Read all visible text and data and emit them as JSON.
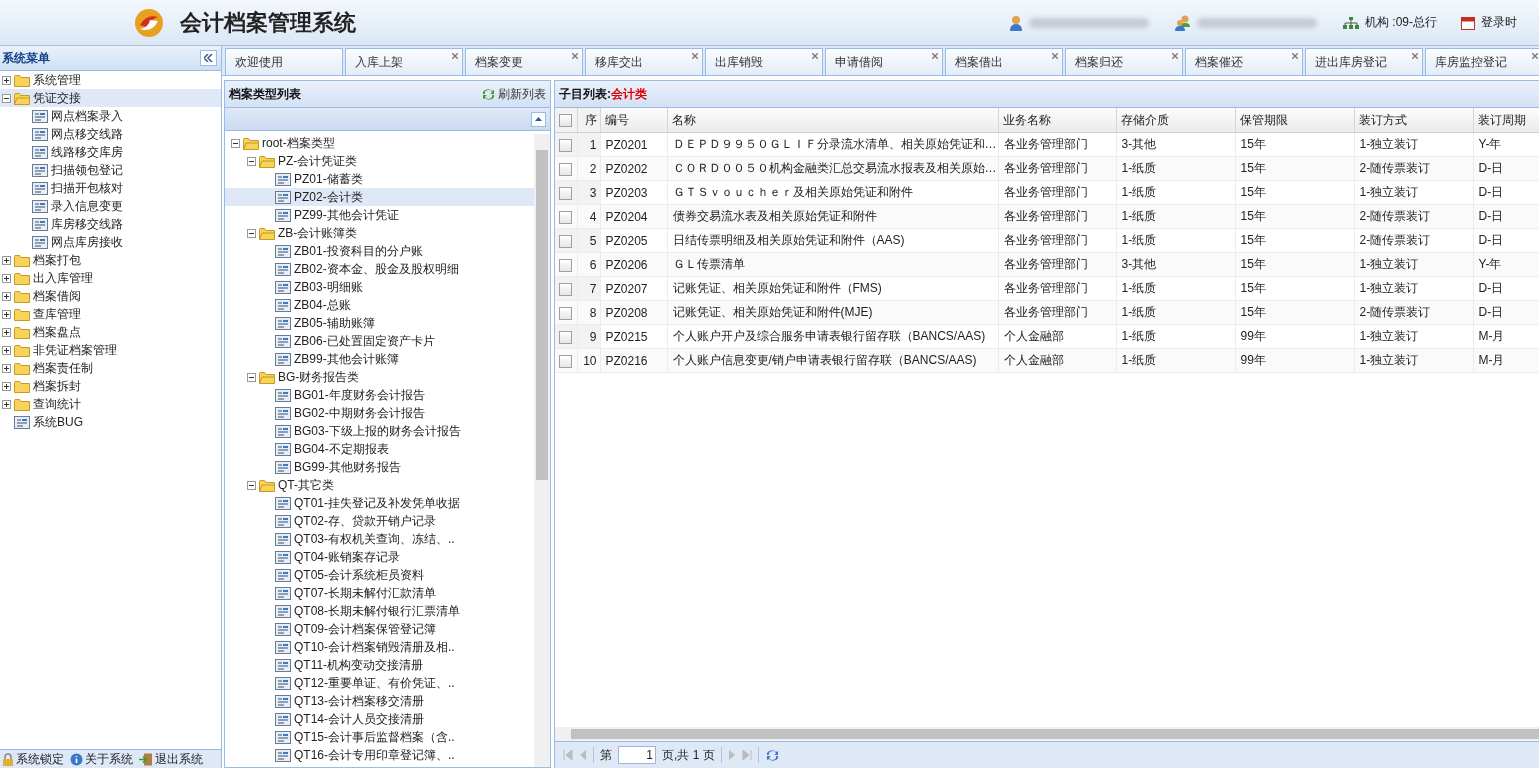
{
  "header": {
    "title": "会计档案管理系统",
    "org": "机构 :09-总行",
    "login": "登录时"
  },
  "sidebar": {
    "title": "系统菜单",
    "items": [
      {
        "label": "系统管理",
        "kind": "folder",
        "expanded": false,
        "selected": false
      },
      {
        "label": "凭证交接",
        "kind": "folder",
        "expanded": true,
        "selected": true,
        "children": [
          {
            "label": "网点档案录入",
            "kind": "page",
            "selected": false
          },
          {
            "label": "网点移交线路",
            "kind": "page",
            "selected": false
          },
          {
            "label": "线路移交库房",
            "kind": "page",
            "selected": false
          },
          {
            "label": "扫描领包登记",
            "kind": "page",
            "selected": false
          },
          {
            "label": "扫描开包核对",
            "kind": "page",
            "selected": false
          },
          {
            "label": "录入信息变更",
            "kind": "page",
            "selected": false
          },
          {
            "label": "库房移交线路",
            "kind": "page",
            "selected": false
          },
          {
            "label": "网点库房接收",
            "kind": "page",
            "selected": false
          }
        ]
      },
      {
        "label": "档案打包",
        "kind": "folder",
        "expanded": false,
        "selected": false
      },
      {
        "label": "出入库管理",
        "kind": "folder",
        "expanded": false,
        "selected": false
      },
      {
        "label": "档案借阅",
        "kind": "folder",
        "expanded": false,
        "selected": false
      },
      {
        "label": "查库管理",
        "kind": "folder",
        "expanded": false,
        "selected": false
      },
      {
        "label": "档案盘点",
        "kind": "folder",
        "expanded": false,
        "selected": false
      },
      {
        "label": "非凭证档案管理",
        "kind": "folder",
        "expanded": false,
        "selected": false
      },
      {
        "label": "档案责任制",
        "kind": "folder",
        "expanded": false,
        "selected": false
      },
      {
        "label": "档案拆封",
        "kind": "folder",
        "expanded": false,
        "selected": false
      },
      {
        "label": "查询统计",
        "kind": "folder",
        "expanded": false,
        "selected": false
      },
      {
        "label": "系统BUG",
        "kind": "page",
        "selected": false
      }
    ],
    "footer": [
      {
        "label": "系统锁定",
        "kind": "lock"
      },
      {
        "label": "关于系统",
        "kind": "info"
      },
      {
        "label": "退出系统",
        "kind": "exit"
      }
    ]
  },
  "tabs": [
    {
      "label": "欢迎使用",
      "selected": false,
      "closable": false
    },
    {
      "label": "入库上架",
      "selected": false,
      "closable": true
    },
    {
      "label": "档案变更",
      "selected": false,
      "closable": true
    },
    {
      "label": "移库交出",
      "selected": false,
      "closable": true
    },
    {
      "label": "出库销毁",
      "selected": false,
      "closable": true
    },
    {
      "label": "申请借阅",
      "selected": false,
      "closable": true
    },
    {
      "label": "档案借出",
      "selected": false,
      "closable": true
    },
    {
      "label": "档案归还",
      "selected": false,
      "closable": true
    },
    {
      "label": "档案催还",
      "selected": false,
      "closable": true
    },
    {
      "label": "进出库房登记",
      "selected": false,
      "closable": true
    },
    {
      "label": "库房监控登记",
      "selected": false,
      "closable": true
    }
  ],
  "type_panel": {
    "title": "档案类型列表",
    "refresh": "刷新列表",
    "tree": [
      {
        "label": "root-档案类型",
        "kind": "folder",
        "expanded": true,
        "selected": false,
        "children": [
          {
            "label": "PZ-会计凭证类",
            "kind": "folder",
            "expanded": true,
            "selected": false,
            "children": [
              {
                "label": "PZ01-储蓄类",
                "kind": "page",
                "selected": false
              },
              {
                "label": "PZ02-会计类",
                "kind": "page",
                "selected": true
              },
              {
                "label": "PZ99-其他会计凭证",
                "kind": "page",
                "selected": false
              }
            ]
          },
          {
            "label": "ZB-会计账簿类",
            "kind": "folder",
            "expanded": true,
            "selected": false,
            "children": [
              {
                "label": "ZB01-投资科目的分户账",
                "kind": "page",
                "selected": false
              },
              {
                "label": "ZB02-资本金、股金及股权明细",
                "kind": "page",
                "selected": false
              },
              {
                "label": "ZB03-明细账",
                "kind": "page",
                "selected": false
              },
              {
                "label": "ZB04-总账",
                "kind": "page",
                "selected": false
              },
              {
                "label": "ZB05-辅助账簿",
                "kind": "page",
                "selected": false
              },
              {
                "label": "ZB06-已处置固定资产卡片",
                "kind": "page",
                "selected": false
              },
              {
                "label": "ZB99-其他会计账簿",
                "kind": "page",
                "selected": false
              }
            ]
          },
          {
            "label": "BG-财务报告类",
            "kind": "folder",
            "expanded": true,
            "selected": false,
            "children": [
              {
                "label": "BG01-年度财务会计报告",
                "kind": "page",
                "selected": false
              },
              {
                "label": "BG02-中期财务会计报告",
                "kind": "page",
                "selected": false
              },
              {
                "label": "BG03-下级上报的财务会计报告",
                "kind": "page",
                "selected": false
              },
              {
                "label": "BG04-不定期报表",
                "kind": "page",
                "selected": false
              },
              {
                "label": "BG99-其他财务报告",
                "kind": "page",
                "selected": false
              }
            ]
          },
          {
            "label": "QT-其它类",
            "kind": "folder",
            "expanded": true,
            "selected": false,
            "children": [
              {
                "label": "QT01-挂失登记及补发凭单收据",
                "kind": "page",
                "selected": false
              },
              {
                "label": "QT02-存、贷款开销户记录",
                "kind": "page",
                "selected": false
              },
              {
                "label": "QT03-有权机关查询、冻结、..",
                "kind": "page",
                "selected": false
              },
              {
                "label": "QT04-账销案存记录",
                "kind": "page",
                "selected": false
              },
              {
                "label": "QT05-会计系统柜员资料",
                "kind": "page",
                "selected": false
              },
              {
                "label": "QT07-长期未解付汇款清单",
                "kind": "page",
                "selected": false
              },
              {
                "label": "QT08-长期未解付银行汇票清单",
                "kind": "page",
                "selected": false
              },
              {
                "label": "QT09-会计档案保管登记簿",
                "kind": "page",
                "selected": false
              },
              {
                "label": "QT10-会计档案销毁清册及相..",
                "kind": "page",
                "selected": false
              },
              {
                "label": "QT11-机构变动交接清册",
                "kind": "page",
                "selected": false
              },
              {
                "label": "QT12-重要单证、有价凭证、..",
                "kind": "page",
                "selected": false
              },
              {
                "label": "QT13-会计档案移交清册",
                "kind": "page",
                "selected": false
              },
              {
                "label": "QT14-会计人员交接清册",
                "kind": "page",
                "selected": false
              },
              {
                "label": "QT15-会计事后监督档案（含..",
                "kind": "page",
                "selected": false
              },
              {
                "label": "QT16-会计专用印章登记簿、..",
                "kind": "page",
                "selected": false
              }
            ]
          }
        ]
      }
    ]
  },
  "grid": {
    "title": "子目列表:",
    "subject": "会计类",
    "all_checked": false,
    "columns": [
      "序",
      "编号",
      "名称",
      "业务名称",
      "存储介质",
      "保管期限",
      "装订方式",
      "装订周期"
    ],
    "rows": [
      {
        "checked": false,
        "cells": [
          "1",
          "PZ0201",
          "ＤＥＰＤ９９５０ＧＬＩＦ分录流水清单、相关原始凭证和…",
          "各业务管理部门",
          "3-其他",
          "15年",
          "1-独立装订",
          "Y-年"
        ]
      },
      {
        "checked": false,
        "cells": [
          "2",
          "PZ0202",
          "ＣＯＲＤ００５０机构金融类汇总交易流水报表及相关原始…",
          "各业务管理部门",
          "1-纸质",
          "15年",
          "2-随传票装订",
          "D-日"
        ]
      },
      {
        "checked": false,
        "cells": [
          "3",
          "PZ0203",
          "ＧＴＳｖｏｕｃｈｅｒ及相关原始凭证和附件",
          "各业务管理部门",
          "1-纸质",
          "15年",
          "1-独立装订",
          "D-日"
        ]
      },
      {
        "checked": false,
        "cells": [
          "4",
          "PZ0204",
          "债券交易流水表及相关原始凭证和附件",
          "各业务管理部门",
          "1-纸质",
          "15年",
          "2-随传票装订",
          "D-日"
        ]
      },
      {
        "checked": false,
        "cells": [
          "5",
          "PZ0205",
          "日结传票明细及相关原始凭证和附件（AAS)",
          "各业务管理部门",
          "1-纸质",
          "15年",
          "2-随传票装订",
          "D-日"
        ]
      },
      {
        "checked": false,
        "cells": [
          "6",
          "PZ0206",
          "ＧＬ传票清单",
          "各业务管理部门",
          "3-其他",
          "15年",
          "1-独立装订",
          "Y-年"
        ]
      },
      {
        "checked": false,
        "cells": [
          "7",
          "PZ0207",
          "记账凭证、相关原始凭证和附件（FMS)",
          "各业务管理部门",
          "1-纸质",
          "15年",
          "1-独立装订",
          "D-日"
        ]
      },
      {
        "checked": false,
        "cells": [
          "8",
          "PZ0208",
          "记账凭证、相关原始凭证和附件(MJE)",
          "各业务管理部门",
          "1-纸质",
          "15年",
          "2-随传票装订",
          "D-日"
        ]
      },
      {
        "checked": false,
        "cells": [
          "9",
          "PZ0215",
          "个人账户开户及综合服务申请表银行留存联（BANCS/AAS)",
          "个人金融部",
          "1-纸质",
          "99年",
          "1-独立装订",
          "M-月"
        ]
      },
      {
        "checked": false,
        "cells": [
          "10",
          "PZ0216",
          "个人账户信息变更/销户申请表银行留存联（BANCS/AAS)",
          "个人金融部",
          "1-纸质",
          "99年",
          "1-独立装订",
          "M-月"
        ]
      }
    ]
  },
  "pager": {
    "before": "第",
    "page": "1",
    "after": "页,共 1 页"
  }
}
